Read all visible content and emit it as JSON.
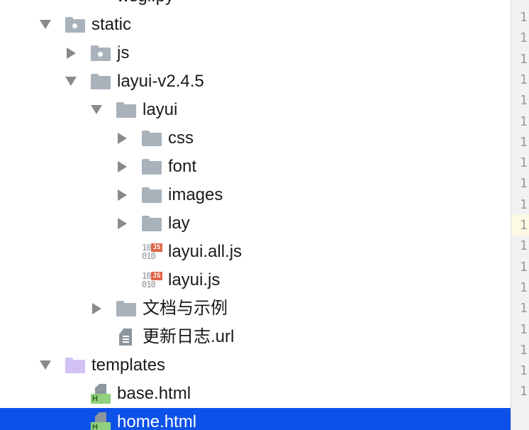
{
  "tree": {
    "rows": [
      {
        "label": "wsgi.py",
        "icon": "python-file-icon",
        "expanded": null
      },
      {
        "label": "static",
        "icon": "resource-folder-icon",
        "expanded": true
      },
      {
        "label": "js",
        "icon": "resource-folder-icon",
        "expanded": false
      },
      {
        "label": "layui-v2.4.5",
        "icon": "folder-icon",
        "expanded": true
      },
      {
        "label": "layui",
        "icon": "folder-icon",
        "expanded": true
      },
      {
        "label": "css",
        "icon": "folder-icon",
        "expanded": false
      },
      {
        "label": "font",
        "icon": "folder-icon",
        "expanded": false
      },
      {
        "label": "images",
        "icon": "folder-icon",
        "expanded": false
      },
      {
        "label": "lay",
        "icon": "folder-icon",
        "expanded": false
      },
      {
        "label": "layui.all.js",
        "icon": "js-file-icon",
        "expanded": null
      },
      {
        "label": "layui.js",
        "icon": "js-file-icon",
        "expanded": null
      },
      {
        "label": "文档与示例",
        "icon": "folder-icon",
        "expanded": false
      },
      {
        "label": "更新日志.url",
        "icon": "text-file-icon",
        "expanded": null
      },
      {
        "label": "templates",
        "icon": "templates-folder-icon",
        "expanded": true
      },
      {
        "label": "base.html",
        "icon": "html-file-icon",
        "expanded": null
      },
      {
        "label": "home.html",
        "icon": "html-file-icon",
        "expanded": null,
        "selected": true
      }
    ],
    "selected_color": "#0d52e8",
    "folder_color": "#a9b2bb",
    "templates_folder_color": "#d2c2f4",
    "js_badge_text": "JS",
    "js_badge_color": "#e0684a",
    "html_badge_text": "H",
    "html_badge_color": "#8fd17e"
  },
  "gutter": {
    "line_numbers": [
      "1",
      "1",
      "1",
      "1",
      "1",
      "1",
      "1",
      "1",
      "1",
      "1",
      "1",
      "1",
      "1",
      "1",
      "1",
      "1",
      "1",
      "1",
      "1"
    ],
    "highlighted_index": 10
  }
}
